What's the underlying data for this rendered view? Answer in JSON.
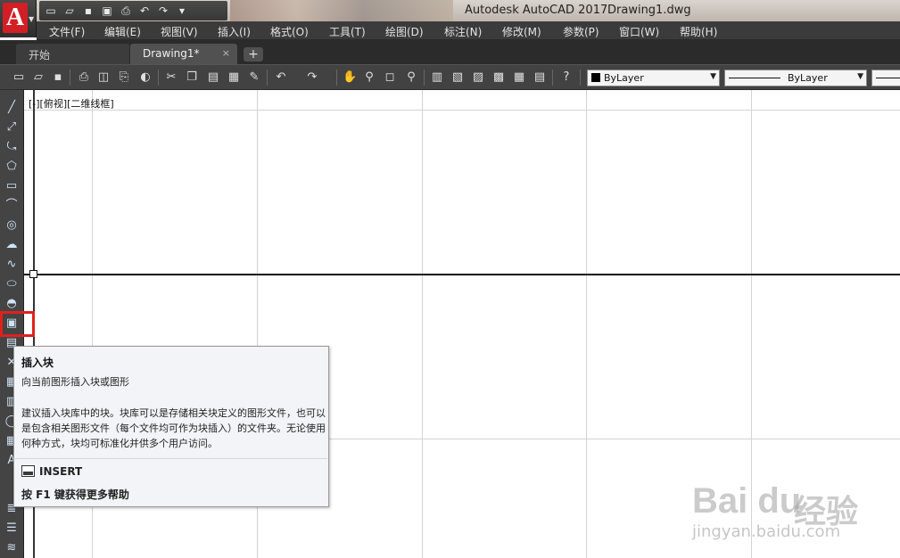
{
  "window": {
    "app_title": "Autodesk AutoCAD 2017",
    "file_title": "Drawing1.dwg"
  },
  "app_button": {
    "logo": "A",
    "icon": "autocad-logo-icon"
  },
  "quick_access": [
    "new-icon",
    "open-icon",
    "save-icon",
    "saveas-icon",
    "plot-icon",
    "undo-icon",
    "redo-icon",
    "customize-icon"
  ],
  "menu": [
    "文件(F)",
    "编辑(E)",
    "视图(V)",
    "插入(I)",
    "格式(O)",
    "工具(T)",
    "绘图(D)",
    "标注(N)",
    "修改(M)",
    "参数(P)",
    "窗口(W)",
    "帮助(H)"
  ],
  "tabs": {
    "home": "开始",
    "active": "Drawing1*",
    "close": "×",
    "add": "+"
  },
  "toolbar": {
    "layer_combo": "ByLayer",
    "linetype_combo": "ByLayer"
  },
  "viewport": {
    "label": "[-][俯视][二维线框]"
  },
  "tooltip": {
    "title": "插入块",
    "description": "向当前图形插入块或图形",
    "long_text": "建议插入块库中的块。块库可以是存储相关块定义的图形文件，也可以是包含相关图形文件（每个文件均可作为块插入）的文件夹。无论使用何种方式，块均可标准化并供多个用户访问。",
    "command": "INSERT",
    "help": "按 F1 键获得更多帮助"
  },
  "watermark": {
    "logo": "Bai du",
    "cn": "经验",
    "url": "jingyan.baidu.com"
  },
  "colors": {
    "highlight": "#e0201d",
    "menubar": "#3b3b3b",
    "logo_red": "#d21f26"
  }
}
